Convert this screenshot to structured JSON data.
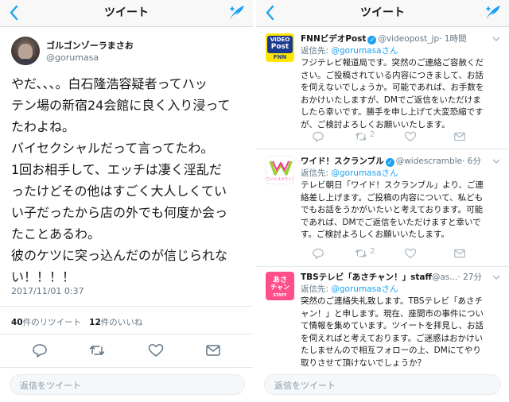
{
  "left": {
    "nav": {
      "title": "ツイート",
      "back_icon": "chevron-left-icon",
      "compose_icon": "compose-feather-icon"
    },
    "tweet": {
      "name": "ゴルゴンゾーラまさお",
      "handle": "@gorumasa",
      "lines": [
        "やだ、、、。白石隆浩容疑者ってハッ",
        "テン場の新宿24会館に良く入り浸って",
        "たわよね。",
        "バイセクシャルだって言ってたわ。",
        "1回お相手して、エッチは凄く淫乱だ",
        "ったけどその他はすごく大人しくてい",
        "い子だったから店の外でも何度か会っ",
        "たことあるわ。",
        "彼のケツに突っ込んだのが信じられな",
        "い！！！！"
      ],
      "timestamp": "2017/11/01 0:37",
      "retweet_count": "40",
      "retweet_label": "件のリツイート",
      "like_count": "12",
      "like_label": "件のいいね"
    },
    "reply_placeholder": "返信をツイート"
  },
  "right": {
    "nav": {
      "title": "ツイート",
      "back_icon": "chevron-left-icon",
      "compose_icon": "compose-feather-icon"
    },
    "tweets": [
      {
        "name": "FNNビデオPost",
        "handle": "@videopost_jp",
        "time": "· 1時間",
        "reply_to_label": "返信先: ",
        "reply_to_handle": "@gorumasaさん",
        "lines": [
          "フジテレビ報道局です。突然のご連絡ご容赦くだ",
          "さい。ご投稿されている内容につきまして、お話",
          "を伺えないでしょうか。可能であれば、お手数を",
          "おかけいたしますが、DMでご返信をいただけま",
          "したら幸いです。勝手を申し上げて大変恐縮です",
          "が、ご検討よろしくお願いいたします。"
        ],
        "retweets": "2"
      },
      {
        "name": "ワイド！スクランブル",
        "handle": "@widescramble",
        "time": "· 6分",
        "reply_to_label": "返信先: ",
        "reply_to_handle": "@gorumasaさん",
        "lines": [
          "テレビ朝日「ワイド！スクランブル」より、ご連",
          "絡差し上げます。ご投稿の内容について、私ども",
          "でもお話をうかがいたいと考えております。可能",
          "であれば、DMでご返信をいただけますと幸いで",
          "す。ご検討よろしくお願いいたします。"
        ],
        "retweets": "2"
      },
      {
        "name": "TBSテレビ「あさチャン！」staff",
        "handle": "@as...",
        "time": "· 27分",
        "reply_to_label": "返信先: ",
        "reply_to_handle": "@gorumasaさん",
        "lines": [
          "突然のご連絡失礼致します。TBSテレビ「あさチ",
          "ャン！」と申します。現在、座間市の事件につい",
          "て情報を集めています。ツイートを拝見し、お話",
          "を伺えればと考えております。ご迷惑はおかけい",
          "たしませんので相互フォローの上、DMにてやり",
          "取りさせて頂けないでしょうか？"
        ]
      }
    ],
    "avatars": {
      "fnn": {
        "line1": "VIDEO",
        "line2": "Post",
        "line3": "FNN"
      },
      "wide": {
        "text": "ワイドスクランブル"
      },
      "tbs": {
        "line1": "あさ",
        "line2": "チャン",
        "line3": "STAFF"
      }
    },
    "reply_placeholder": "返信をツイート"
  },
  "colors": {
    "accent": "#1da1f2",
    "text": "#14171a",
    "muted": "#657786",
    "separator": "#e1e8ed"
  }
}
